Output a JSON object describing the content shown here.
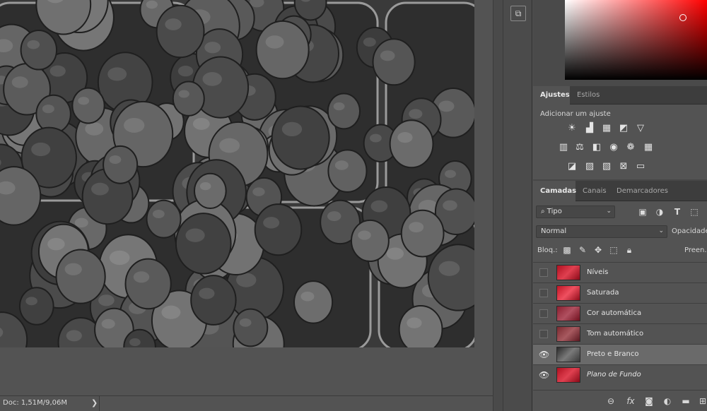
{
  "status": {
    "doc_info": "Doc: 1,51M/9,06M",
    "arrow": "❯"
  },
  "dock": {
    "tool_icon": "arrange-icon"
  },
  "colors": {
    "accent_red": "#ff0000",
    "panel_bg": "#535353"
  },
  "adjust_panel": {
    "tabs": [
      "Ajustes",
      "Estilos"
    ],
    "title": "Adicionar um ajuste",
    "row1": [
      "brightness-icon",
      "levels-icon",
      "curves-icon",
      "exposure-icon",
      "gradient-triangle-icon"
    ],
    "row2": [
      "vibrance-icon",
      "balance-icon",
      "black-white-icon",
      "photo-filter-icon",
      "channel-mixer-icon",
      "color-lookup-icon"
    ],
    "row3": [
      "invert-icon",
      "posterize-icon",
      "threshold-icon",
      "selective-color-icon",
      "gradient-map-icon"
    ]
  },
  "layers_panel": {
    "tabs": [
      "Camadas",
      "Canais",
      "Demarcadores"
    ],
    "filter_label": "Tipo",
    "blend_mode": "Normal",
    "opacity_label": "Opacidade:",
    "lock_label": "Bloq.:",
    "fill_label": "Preen.",
    "layers": [
      {
        "name": "Níveis",
        "visible": false,
        "italic": false,
        "selected": false
      },
      {
        "name": "Saturada",
        "visible": false,
        "italic": false,
        "selected": false
      },
      {
        "name": "Cor automática",
        "visible": false,
        "italic": false,
        "selected": false
      },
      {
        "name": "Tom automático",
        "visible": false,
        "italic": false,
        "selected": false
      },
      {
        "name": "Preto e Branco",
        "visible": true,
        "italic": false,
        "selected": true
      },
      {
        "name": "Plano de Fundo",
        "visible": true,
        "italic": true,
        "selected": false
      }
    ],
    "footer_icons": [
      "link-icon",
      "fx-icon",
      "mask-icon",
      "adjustment-layer-icon",
      "folder-icon",
      "new-layer-icon",
      "trash-icon"
    ]
  }
}
